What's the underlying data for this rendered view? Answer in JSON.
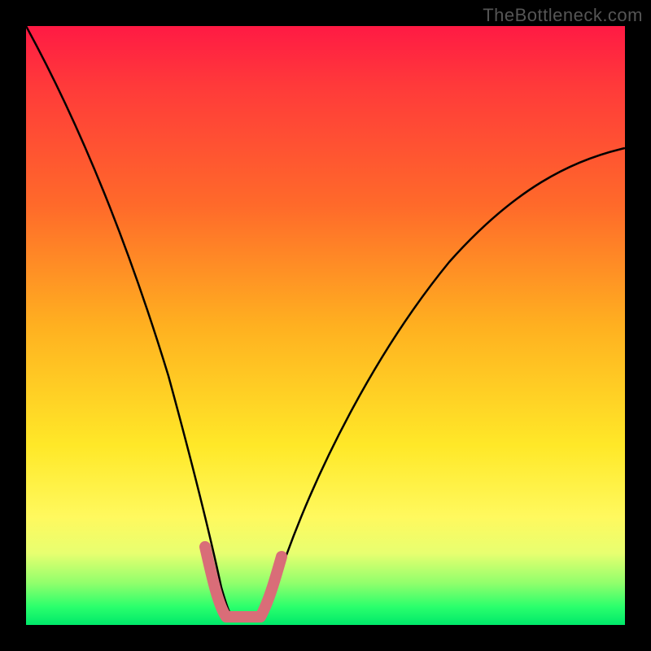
{
  "watermark": "TheBottleneck.com",
  "chart_data": {
    "type": "line",
    "title": "",
    "xlabel": "",
    "ylabel": "",
    "xlim": [
      0,
      100
    ],
    "ylim": [
      0,
      100
    ],
    "grid": false,
    "legend": false,
    "series": [
      {
        "name": "bottleneck-curve",
        "x": [
          0,
          5,
          10,
          15,
          20,
          24,
          27,
          30,
          32,
          34,
          36,
          40,
          50,
          60,
          70,
          80,
          90,
          100
        ],
        "y": [
          100,
          88,
          76,
          63,
          49,
          33,
          18,
          6,
          1,
          0.5,
          1,
          8,
          30,
          48,
          60,
          69,
          75,
          80
        ]
      }
    ],
    "highlight": {
      "name": "optimal-zone",
      "x": [
        27,
        29,
        31,
        33,
        35,
        37,
        39
      ],
      "y": [
        14,
        4,
        1,
        1,
        1,
        4,
        10
      ],
      "color": "#d96d78"
    },
    "background_gradient": {
      "stops": [
        {
          "pos": 0,
          "color": "#ff1a44"
        },
        {
          "pos": 30,
          "color": "#ff6a2a"
        },
        {
          "pos": 60,
          "color": "#ffe828"
        },
        {
          "pos": 90,
          "color": "#91ff6c"
        },
        {
          "pos": 100,
          "color": "#00e86a"
        }
      ]
    }
  }
}
